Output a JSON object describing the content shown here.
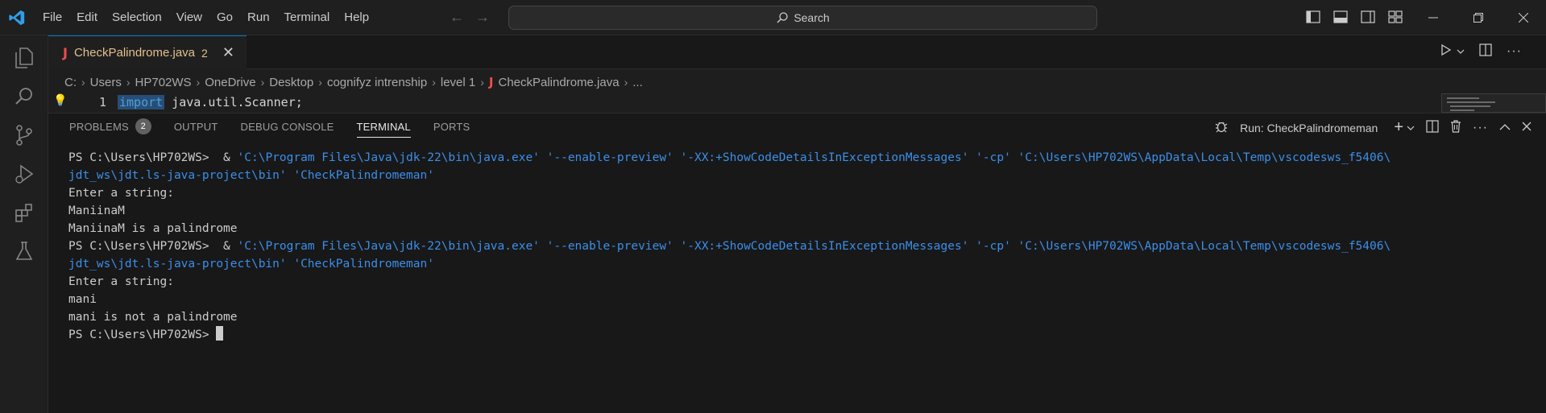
{
  "menu": [
    "File",
    "Edit",
    "Selection",
    "View",
    "Go",
    "Run",
    "Terminal",
    "Help"
  ],
  "search": {
    "label": "Search"
  },
  "tab": {
    "java_glyph": "J",
    "filename": "CheckPalindrome.java",
    "problems": "2",
    "close": "✕"
  },
  "breadcrumb": [
    "C:",
    "Users",
    "HP702WS",
    "OneDrive",
    "Desktop",
    "cognifyz intrenship",
    "level 1",
    "CheckPalindrome.java",
    "..."
  ],
  "editor": {
    "line_number": "1",
    "keyword": "import",
    "rest": " java.util.Scanner;"
  },
  "panel": {
    "tabs": [
      "PROBLEMS",
      "OUTPUT",
      "DEBUG CONSOLE",
      "TERMINAL",
      "PORTS"
    ],
    "problems_count": "2",
    "active_tab": "TERMINAL",
    "run_label": "Run: CheckPalindromeman"
  },
  "terminal": {
    "prompt": "PS C:\\Users\\HP702WS> ",
    "cmd_part1": " & ",
    "cmd_str1": "'C:\\Program Files\\Java\\jdk-22\\bin\\java.exe' '--enable-preview' '-XX:+ShowCodeDetailsInExceptionMessages' '-cp' 'C:\\Users\\HP702WS\\AppData\\Local\\Temp\\vscodesws_f5406\\",
    "cmd_str2": "jdt_ws\\jdt.ls-java-project\\bin' 'CheckPalindromeman'",
    "lines_run1": [
      "Enter a string:",
      "ManiinaM",
      "ManiinaM is a palindrome"
    ],
    "lines_run2": [
      "Enter a string:",
      "mani",
      "mani is not a palindrome"
    ]
  },
  "colors": {
    "accent": "#0078d4",
    "string": "#3b8eea",
    "tab_label": "#e2c08d",
    "java_icon": "#f14c4c"
  }
}
